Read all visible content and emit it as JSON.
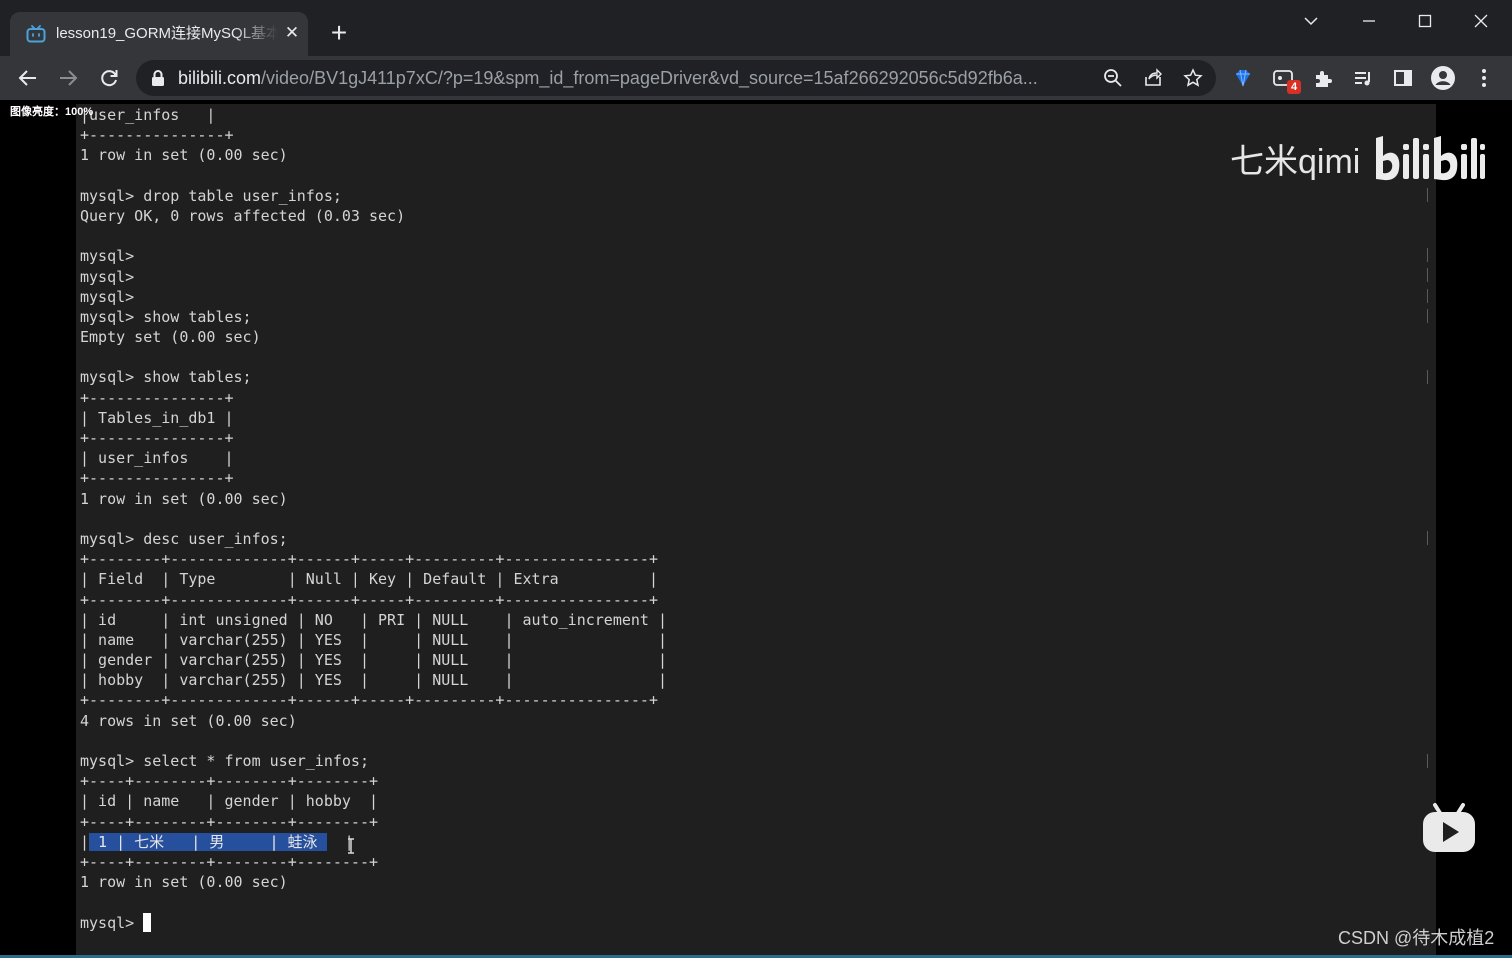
{
  "browser": {
    "tab_title": "lesson19_GORM连接MySQL基本示例",
    "new_tab_symbol": "+",
    "url_host": "bilibili.com",
    "url_path": "/video/BV1gJ411p7xC/?p=19&spm_id_from=pageDriver&vd_source=15af266292056c5d92fb6a...",
    "extension_badge_count": "4",
    "accent_colors": {
      "tab_bar": "#202124",
      "toolbar": "#35363a",
      "badge": "#d93025"
    }
  },
  "overlay": {
    "brightness_label": "图像亮度：100%",
    "watermark_text": "七米qimi",
    "bilibili_logo": "bilibili",
    "csdn_credit": "CSDN @待木成植2"
  },
  "terminal": {
    "lines": [
      "|user_infos   |",
      "+---------------+",
      "1 row in set (0.00 sec)",
      "",
      "mysql> drop table user_infos;",
      "Query OK, 0 rows affected (0.03 sec)",
      "",
      "mysql>",
      "mysql>",
      "mysql>",
      "mysql> show tables;",
      "Empty set (0.00 sec)",
      "",
      "mysql> show tables;",
      "+---------------+",
      "| Tables_in_db1 |",
      "+---------------+",
      "| user_infos    |",
      "+---------------+",
      "1 row in set (0.00 sec)",
      "",
      "mysql> desc user_infos;",
      "+--------+-------------+------+-----+---------+----------------+",
      "| Field  | Type        | Null | Key | Default | Extra          |",
      "+--------+-------------+------+-----+---------+----------------+",
      "| id     | int unsigned | NO   | PRI | NULL    | auto_increment |",
      "| name   | varchar(255) | YES  |     | NULL    |                |",
      "| gender | varchar(255) | YES  |     | NULL    |                |",
      "| hobby  | varchar(255) | YES  |     | NULL    |                |",
      "+--------+-------------+------+-----+---------+----------------+",
      "4 rows in set (0.00 sec)",
      "",
      "mysql> select * from user_infos;",
      "+----+--------+--------+--------+",
      "| id | name   | gender | hobby  |",
      "+----+--------+--------+--------+",
      "|",
      "+----+--------+--------+--------+",
      "1 row in set (0.00 sec)",
      "",
      "mysql> "
    ],
    "selected_row_text": " 1 | 七米   | 男     | 蛙泳 ",
    "selected_row_end": "  |",
    "selection_color": "#264f9e"
  }
}
